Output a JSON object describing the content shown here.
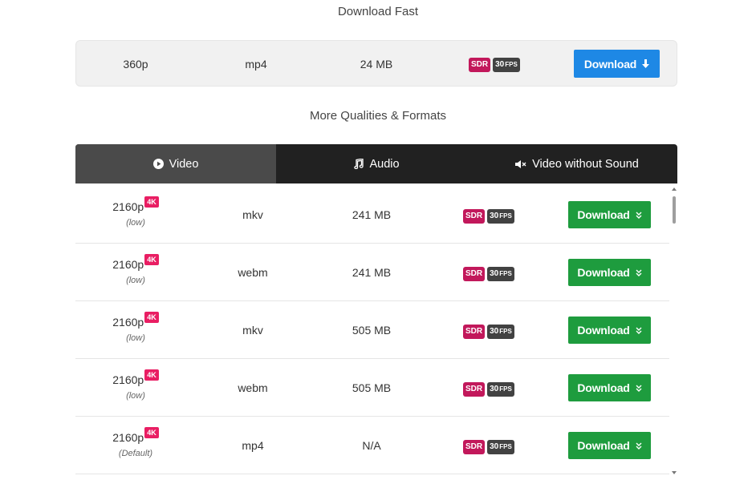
{
  "download_fast": {
    "heading": "Download Fast",
    "resolution": "360p",
    "format": "mp4",
    "size": "24 MB",
    "badges": {
      "sdr": "SDR",
      "fps_number": "30",
      "fps_unit": "FPS"
    },
    "button_label": "Download",
    "button_icon": "arrow-down-icon",
    "button_color": "#1e88e5"
  },
  "more": {
    "heading": "More Qualities & Formats",
    "tabs": [
      {
        "label": "Video",
        "icon": "play-circle-icon",
        "active": true
      },
      {
        "label": "Audio",
        "icon": "music-note-icon",
        "active": false
      },
      {
        "label": "Video without Sound",
        "icon": "volume-mute-icon",
        "active": false
      }
    ],
    "rows": [
      {
        "resolution": "2160p",
        "quality_badge": "4K",
        "note": "(low)",
        "format": "mkv",
        "size": "241 MB",
        "sdr": "SDR",
        "fps_number": "30",
        "fps_unit": "FPS",
        "button_label": "Download"
      },
      {
        "resolution": "2160p",
        "quality_badge": "4K",
        "note": "(low)",
        "format": "webm",
        "size": "241 MB",
        "sdr": "SDR",
        "fps_number": "30",
        "fps_unit": "FPS",
        "button_label": "Download"
      },
      {
        "resolution": "2160p",
        "quality_badge": "4K",
        "note": "(low)",
        "format": "mkv",
        "size": "505 MB",
        "sdr": "SDR",
        "fps_number": "30",
        "fps_unit": "FPS",
        "button_label": "Download"
      },
      {
        "resolution": "2160p",
        "quality_badge": "4K",
        "note": "(low)",
        "format": "webm",
        "size": "505 MB",
        "sdr": "SDR",
        "fps_number": "30",
        "fps_unit": "FPS",
        "button_label": "Download"
      },
      {
        "resolution": "2160p",
        "quality_badge": "4K",
        "note": "(Default)",
        "format": "mp4",
        "size": "N/A",
        "sdr": "SDR",
        "fps_number": "30",
        "fps_unit": "FPS",
        "button_label": "Download"
      }
    ],
    "row_button_icon": "chevron-double-down-icon",
    "row_button_color": "#1e9c3e"
  },
  "colors": {
    "sdr_badge": "#c2185b",
    "fps_badge": "#424242",
    "quality_badge": "#e91e63",
    "tab_bar": "#212121",
    "tab_active": "#4a4a4a"
  }
}
